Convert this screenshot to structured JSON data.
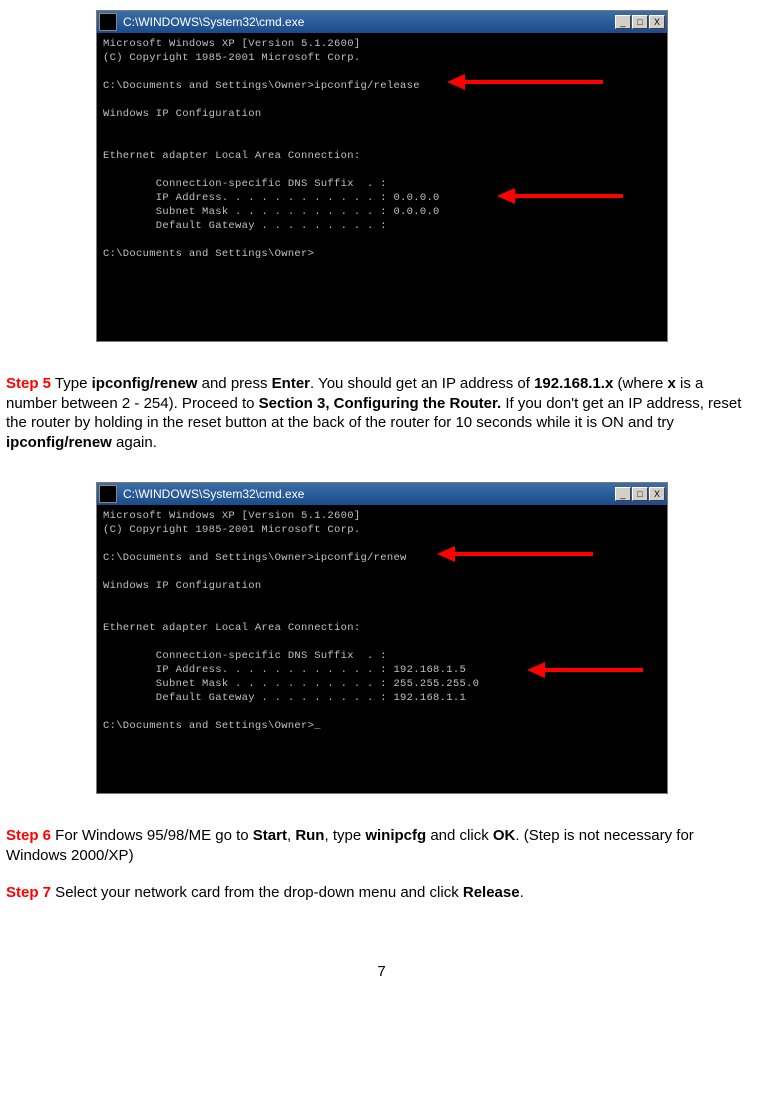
{
  "cmd1": {
    "title": "C:\\WINDOWS\\System32\\cmd.exe",
    "min": "_",
    "max": "□",
    "close": "X",
    "line1": "Microsoft Windows XP [Version 5.1.2600]",
    "line2": "(C) Copyright 1985-2001 Microsoft Corp.",
    "line3": "C:\\Documents and Settings\\Owner>ipconfig/release",
    "line4": "Windows IP Configuration",
    "line5": "Ethernet adapter Local Area Connection:",
    "line6": "        Connection-specific DNS Suffix  . :",
    "line7": "        IP Address. . . . . . . . . . . . : 0.0.0.0",
    "line8": "        Subnet Mask . . . . . . . . . . . : 0.0.0.0",
    "line9": "        Default Gateway . . . . . . . . . :",
    "line10": "C:\\Documents and Settings\\Owner>"
  },
  "step5": {
    "label": "Step 5",
    "t1": " Type ",
    "b1": "ipconfig/renew",
    "t2": " and press ",
    "b2": "Enter",
    "t3": ". You should get an IP address of ",
    "b3": "192.168.1.x",
    "t4": " (where ",
    "b4": "x",
    "t5": " is a number between 2 - 254). Proceed to ",
    "b5": "Section 3, Configuring the Router.",
    "t6": " If you don't get an IP address, reset the router by holding in the reset button at the back of the router for 10 seconds while it is ON and try ",
    "b6": "ipconfig/renew",
    "t7": " again."
  },
  "cmd2": {
    "title": "C:\\WINDOWS\\System32\\cmd.exe",
    "min": "_",
    "max": "□",
    "close": "X",
    "line1": "Microsoft Windows XP [Version 5.1.2600]",
    "line2": "(C) Copyright 1985-2001 Microsoft Corp.",
    "line3": "C:\\Documents and Settings\\Owner>ipconfig/renew",
    "line4": "Windows IP Configuration",
    "line5": "Ethernet adapter Local Area Connection:",
    "line6": "        Connection-specific DNS Suffix  . :",
    "line7": "        IP Address. . . . . . . . . . . . : 192.168.1.5",
    "line8": "        Subnet Mask . . . . . . . . . . . : 255.255.255.0",
    "line9": "        Default Gateway . . . . . . . . . : 192.168.1.1",
    "line10": "C:\\Documents and Settings\\Owner>_"
  },
  "step6": {
    "label": "Step 6",
    "t1": " For Windows 95/98/ME go to ",
    "b1": "Start",
    "t2": ", ",
    "b2": "Run",
    "t3": ", type ",
    "b3": "winipcfg",
    "t4": " and click ",
    "b4": "OK",
    "t5": ". (Step is not necessary for Windows 2000/XP)"
  },
  "step7": {
    "label": "Step 7",
    "t1": " Select your network card from the drop-down menu and click ",
    "b1": "Release",
    "t2": "."
  },
  "pagenum": "7"
}
